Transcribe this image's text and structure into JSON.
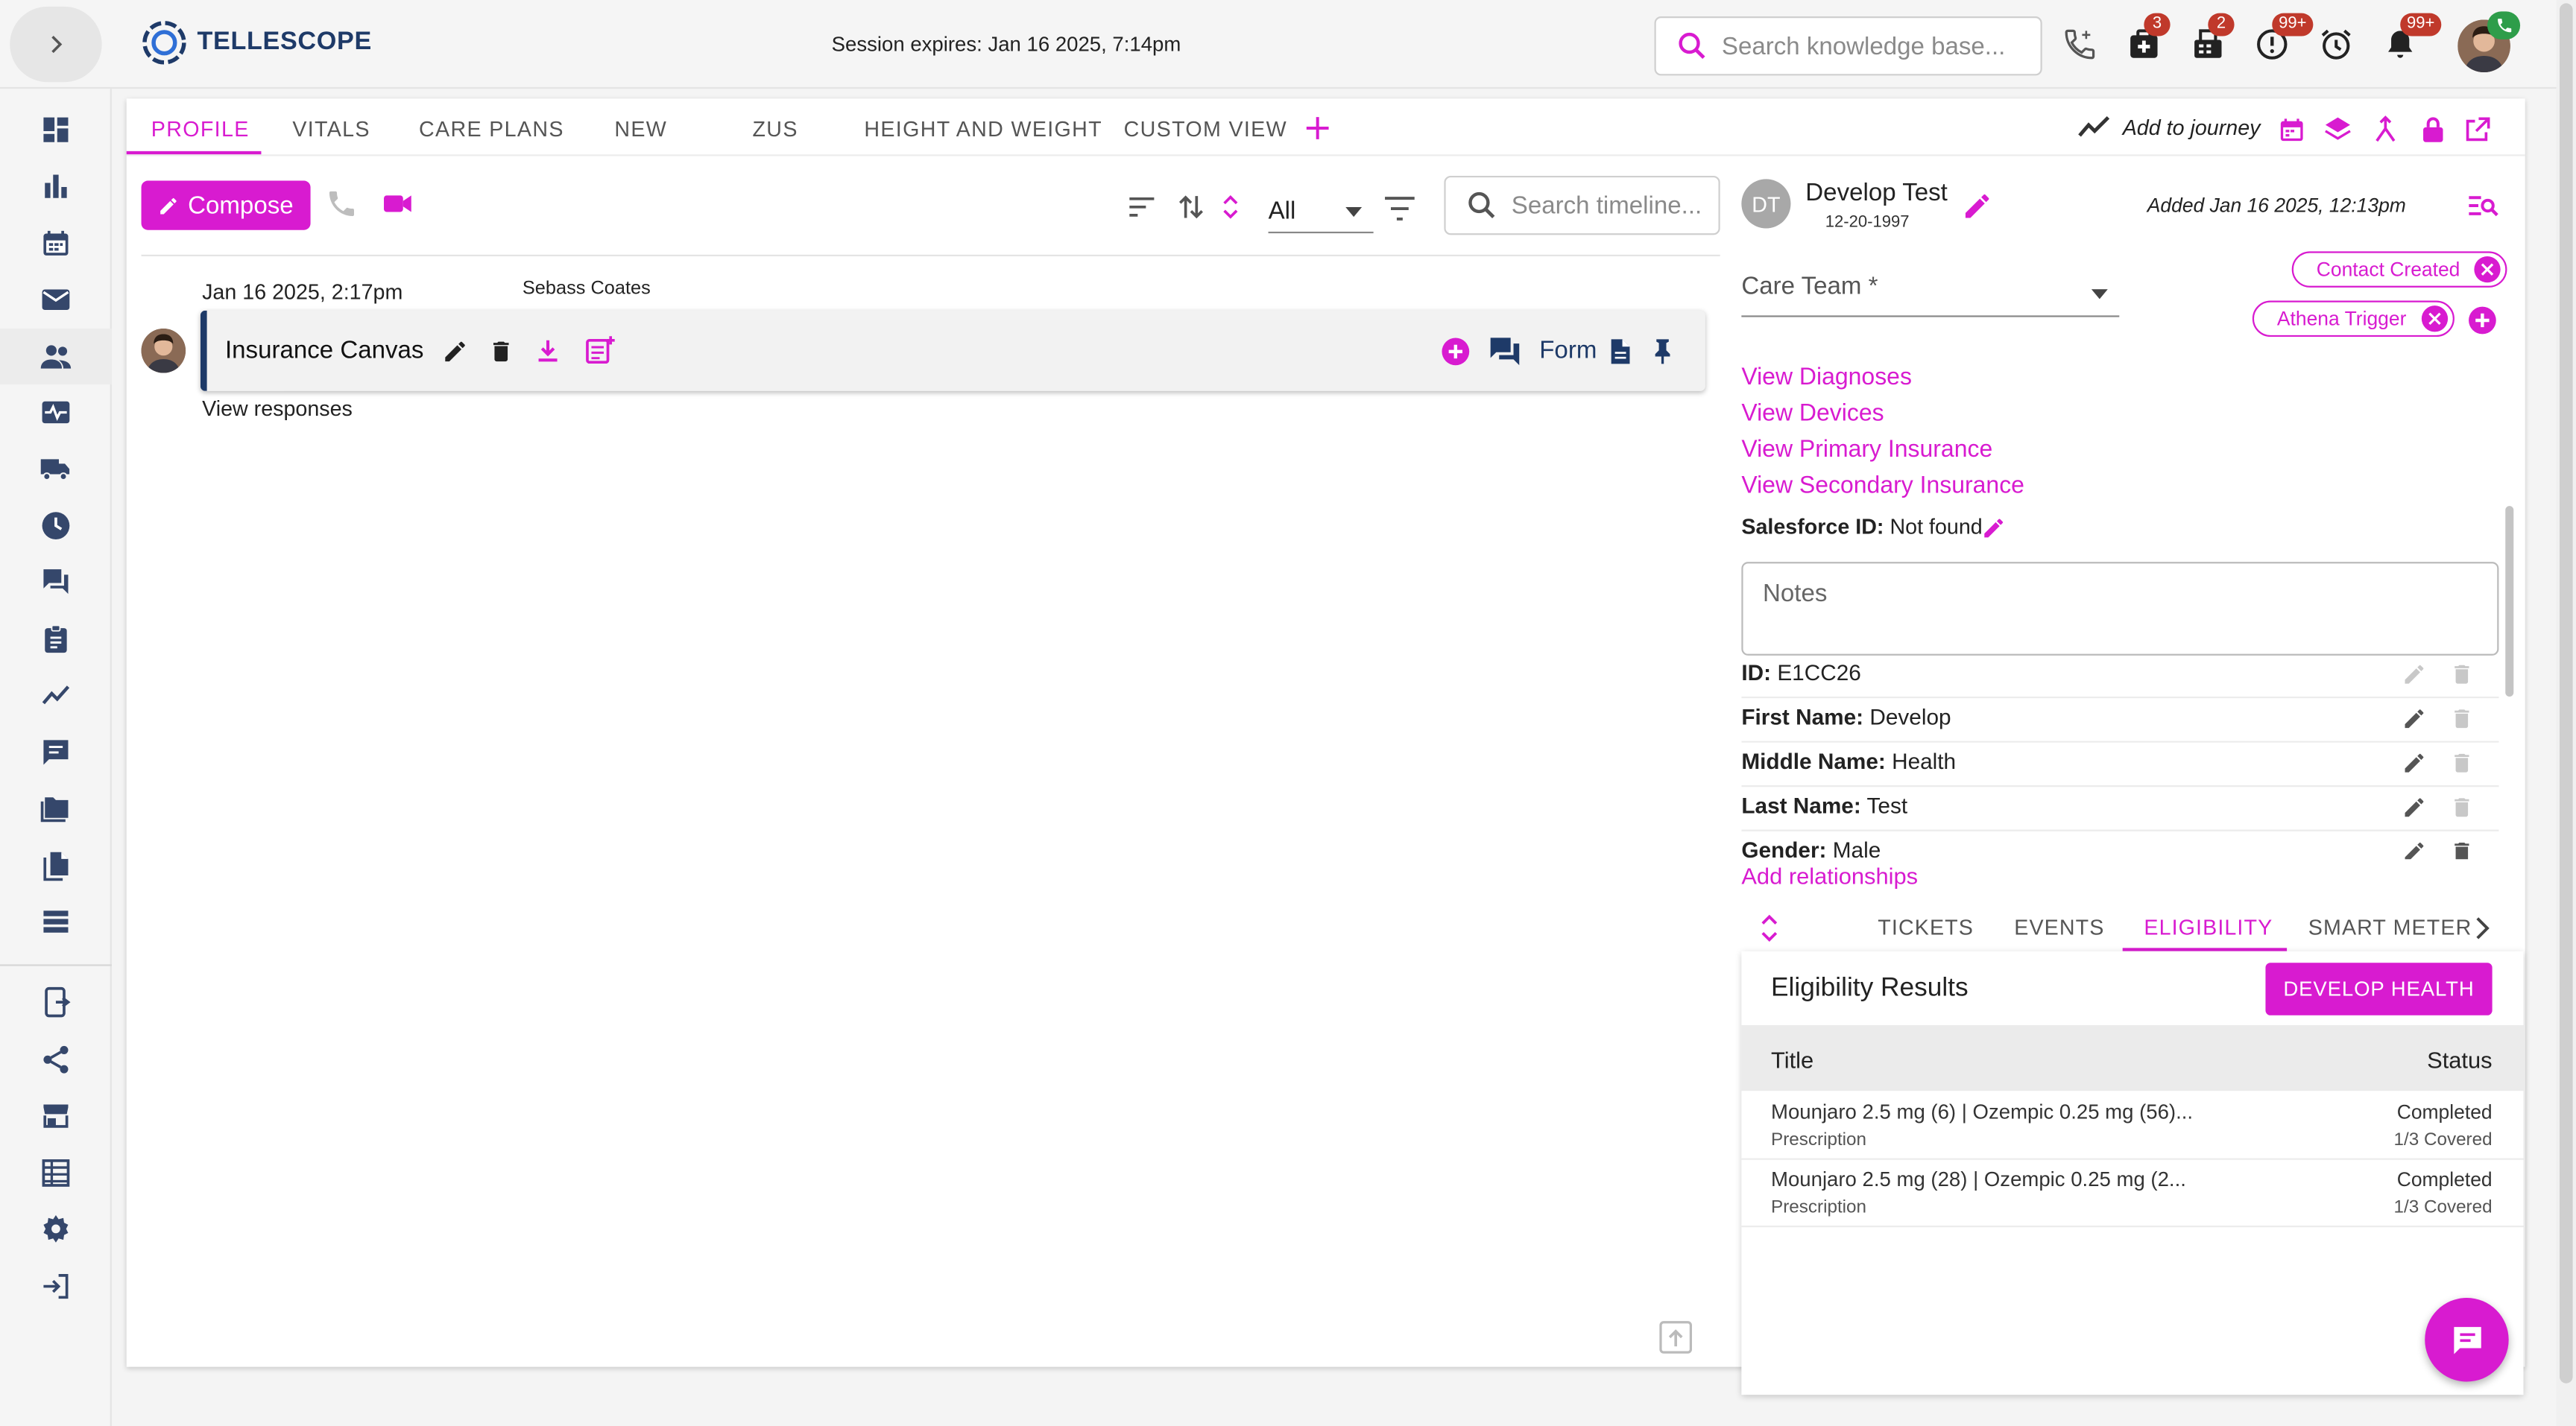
{
  "app": {
    "name": "TELLESCOPE",
    "brand_color": "#d81bd0",
    "logo_color": "#1e3a68"
  },
  "header": {
    "session_text": "Session expires: Jan 16 2025, 7:14pm",
    "search_placeholder": "Search knowledge base...",
    "icons": [
      {
        "name": "phone-icon",
        "badge": ""
      },
      {
        "name": "medical-plus-icon",
        "badge": "3"
      },
      {
        "name": "fax-icon",
        "badge": "2"
      },
      {
        "name": "alert-circle-icon",
        "badge": "99+"
      },
      {
        "name": "alarm-icon",
        "badge": ""
      },
      {
        "name": "bell-icon",
        "badge": "99+"
      }
    ]
  },
  "sidebar": {
    "items": [
      "dashboard-icon",
      "bar-chart-icon",
      "calendar-icon",
      "mail-icon",
      "people-icon",
      "monitor-heart-icon",
      "truck-icon",
      "clock-icon",
      "forum-icon",
      "clipboard-icon",
      "trending-icon",
      "message-icon",
      "folder-icon",
      "file-copy-icon",
      "list-icon",
      "mobile-form-icon",
      "share-icon",
      "store-icon",
      "table-icon",
      "gear-icon",
      "logout-icon"
    ],
    "active_index": 4
  },
  "tabs": [
    "PROFILE",
    "VITALS",
    "CARE PLANS",
    "NEW",
    "ZUS",
    "HEIGHT AND WEIGHT",
    "CUSTOM VIEW"
  ],
  "toolbar": {
    "add_to_journey": "Add to journey"
  },
  "timeline": {
    "compose_label": "Compose",
    "filter_value": "All",
    "search_placeholder": "Search timeline...",
    "events": [
      {
        "date": "Jan 16 2025, 2:17pm",
        "author": "Sebass Coates",
        "title": "Insurance Canvas",
        "form_label": "Form",
        "view_responses": "View responses"
      }
    ]
  },
  "profile": {
    "initials": "DT",
    "name": "Develop Test",
    "dob": "12-20-1997",
    "added": "Added Jan 16 2025, 12:13pm",
    "care_team_label": "Care Team *",
    "tags": [
      "Contact Created",
      "Athena Trigger"
    ],
    "links": [
      "View Diagnoses",
      "View Devices",
      "View Primary Insurance",
      "View Secondary Insurance"
    ],
    "salesforce_label": "Salesforce ID:",
    "salesforce_value": "Not found",
    "notes_placeholder": "Notes",
    "fields": [
      {
        "label": "ID:",
        "value": "E1CC26"
      },
      {
        "label": "First Name:",
        "value": "Develop"
      },
      {
        "label": "Middle Name:",
        "value": "Health"
      },
      {
        "label": "Last Name:",
        "value": "Test"
      },
      {
        "label": "Gender:",
        "value": "Male"
      }
    ],
    "add_relationships": "Add relationships"
  },
  "subtabs": [
    "TICKETS",
    "EVENTS",
    "ELIGIBILITY",
    "SMART METER"
  ],
  "eligibility": {
    "title": "Eligibility Results",
    "button": "DEVELOP HEALTH",
    "col_title": "Title",
    "col_status": "Status",
    "rows": [
      {
        "title": "Mounjaro 2.5 mg (6) | Ozempic 0.25 mg (56)...",
        "type": "Prescription",
        "status": "Completed",
        "coverage": "1/3 Covered"
      },
      {
        "title": "Mounjaro 2.5 mg (28) | Ozempic 0.25 mg (2...",
        "type": "Prescription",
        "status": "Completed",
        "coverage": "1/3 Covered"
      }
    ]
  }
}
